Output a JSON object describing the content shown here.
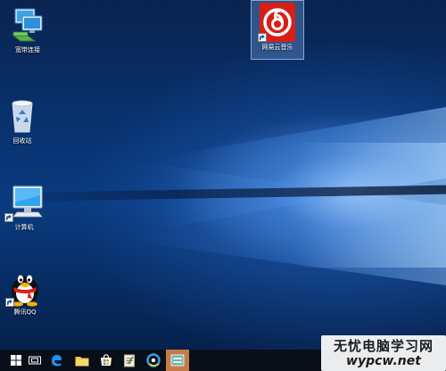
{
  "desktop": {
    "icons": {
      "broadband": {
        "label": "宽带连接",
        "icon": "network-connection-icon"
      },
      "recycle": {
        "label": "回收站",
        "icon": "recycle-bin-icon"
      },
      "computer": {
        "label": "计算机",
        "icon": "computer-icon"
      },
      "qq": {
        "label": "腾讯QQ",
        "icon": "qq-penguin-icon"
      },
      "music": {
        "label": "网易云音乐",
        "icon": "netease-cloud-music-icon"
      }
    }
  },
  "taskbar": {
    "items": [
      {
        "icon": "windows-start-icon"
      },
      {
        "icon": "task-view-icon"
      },
      {
        "icon": "edge-browser-icon"
      },
      {
        "icon": "file-explorer-icon"
      },
      {
        "icon": "store-icon"
      },
      {
        "icon": "notepad-app-icon"
      },
      {
        "icon": "qq-browser-icon"
      },
      {
        "icon": "active-app-icon"
      }
    ],
    "active_color": "#c77a4a"
  },
  "watermark": {
    "title": "无忧电脑学习网",
    "site": "wypcw.net"
  },
  "colors": {
    "netease_red": "#d91e18",
    "wallpaper_dark": "#08306b",
    "wallpaper_light": "#aad2ff"
  }
}
